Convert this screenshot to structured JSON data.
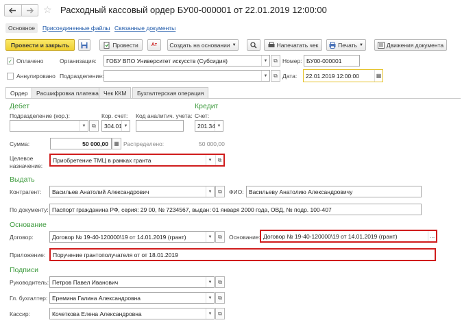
{
  "window": {
    "title": "Расходный кассовый ордер БУ00-000001 от 22.01.2019 12:00:00"
  },
  "nav": {
    "back_icon": "arrow-left-icon",
    "forward_icon": "arrow-right-icon",
    "star_icon": "star-icon"
  },
  "links": {
    "main": "Основное",
    "attached_files": "Присоединенные файлы",
    "related_docs": "Связанные документы"
  },
  "toolbar": {
    "post_close": "Провести и закрыть",
    "save_icon": "floppy-icon",
    "post": "Провести",
    "create_based_on": "Создать на основании",
    "print_receipt": "Напечатать чек",
    "print": "Печать",
    "movements": "Движения документа"
  },
  "header": {
    "paid_label": "Оплачено",
    "paid_checked": true,
    "cancelled_label": "Аннулировано",
    "cancelled_checked": false,
    "org_label": "Организация:",
    "org_value": "ГОБУ ВПО Университет искусств (Субсидия)",
    "number_label": "Номер:",
    "number_value": "БУ00-000001",
    "dept_label": "Подразделение:",
    "dept_value": "",
    "date_label": "Дата:",
    "date_value": "22.01.2019 12:00:00"
  },
  "tabs": [
    {
      "label": "Ордер",
      "active": true
    },
    {
      "label": "Расшифровка платежа",
      "active": false
    },
    {
      "label": "Чек ККМ",
      "active": false
    },
    {
      "label": "Бухгалтерская операция",
      "active": false
    }
  ],
  "debit": {
    "title": "Дебет",
    "dept_corr_label": "Подразделение (кор.):",
    "dept_corr_value": "",
    "corr_account_label": "Кор. счет:",
    "corr_account_value": "304.01",
    "analytic_label": "Код аналитич. учета:",
    "analytic_value": ""
  },
  "credit": {
    "title": "Кредит",
    "account_label": "Счет:",
    "account_value": "201.34"
  },
  "amount": {
    "label": "Сумма:",
    "value": "50 000,00",
    "distributed_label": "Распределено:",
    "distributed_value": "50 000,00"
  },
  "purpose": {
    "label_line1": "Целевое",
    "label_line2": "назначение:",
    "value": "Приобретение ТМЦ в рамках гранта"
  },
  "issue": {
    "title": "Выдать",
    "contractor_label": "Контрагент:",
    "contractor_value": "Васильев Анатолий Александрович",
    "fio_label": "ФИО:",
    "fio_value": "Васильеву Анатолию Александровичу",
    "doc_label": "По документу:",
    "doc_value": "Паспорт гражданина РФ, серия: 29 00, № 7234567, выдан: 01 января 2000 года, ОВД, № подр. 100-407"
  },
  "basis": {
    "title": "Основание",
    "contract_label": "Договор:",
    "contract_value": "Договор № 19-40-120000\\19 от 14.01.2019 (грант)",
    "basis_label": "Основание:",
    "basis_value": "Договор № 19-40-120000\\19 от 14.01.2019 (грант)",
    "appendix_label": "Приложение:",
    "appendix_value": "Поручение грантополучателя от от 18.01.2019"
  },
  "signatures": {
    "title": "Подписи",
    "head_label": "Руководитель:",
    "head_value": "Петров Павел Иванович",
    "chief_acc_label": "Гл. бухгалтер:",
    "chief_acc_value": "Еремина Галина Александровна",
    "cashier_label": "Кассир:",
    "cashier_value": "Кочеткова Елена Александровна"
  },
  "colors": {
    "accent_green": "#3c9a3c",
    "highlight_red": "#d01c1c",
    "primary_yellow": "#f5dc4a",
    "link_blue": "#1a56a8"
  }
}
